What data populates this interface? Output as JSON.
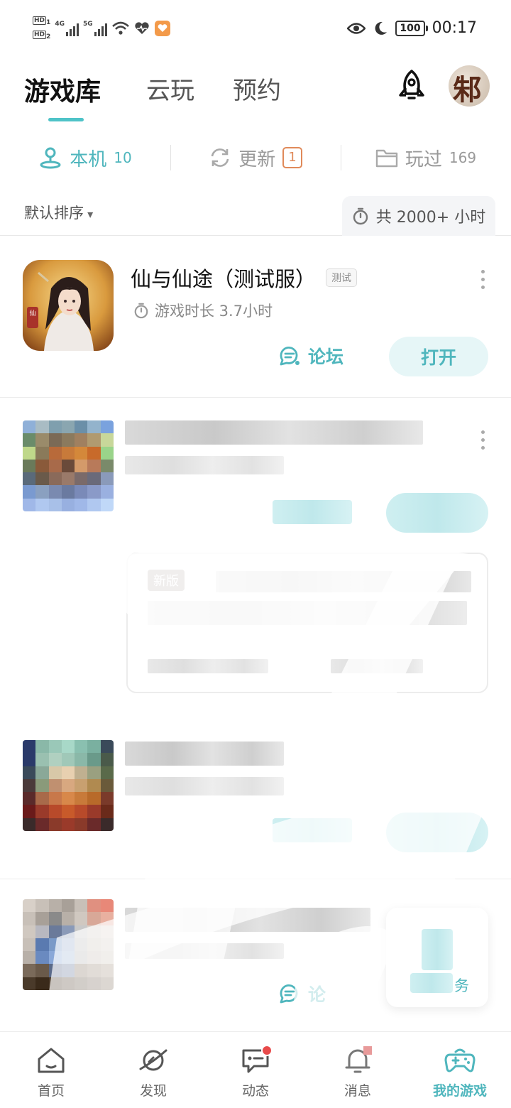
{
  "status_bar": {
    "hd1": "HD",
    "hd1_sub": "1",
    "hd2": "HD",
    "hd2_sub": "2",
    "net1": "4G",
    "net2": "5G",
    "battery": "100",
    "time": "00:17"
  },
  "header": {
    "tabs": [
      {
        "label": "游戏库",
        "active": true
      },
      {
        "label": "云玩",
        "active": false
      },
      {
        "label": "预约",
        "active": false
      }
    ],
    "avatar_text": "邾"
  },
  "filters": [
    {
      "label": "本机",
      "count": "10",
      "active": true
    },
    {
      "label": "更新",
      "count": "1",
      "active": false
    },
    {
      "label": "玩过",
      "count": "169",
      "active": false
    }
  ],
  "sort": {
    "label": "默认排序",
    "total_playtime": "共 2000+ 小时"
  },
  "games": [
    {
      "title": "仙与仙途（测试服）",
      "tag": "测试",
      "playtime": "游戏时长 3.7小时",
      "forum_label": "论坛",
      "open_label": "打开"
    }
  ],
  "obscured": {
    "news_tag": "新版",
    "forum_partial": "论",
    "task_partial": "务"
  },
  "bottom_nav": [
    {
      "label": "首页",
      "icon": "home-icon",
      "active": false
    },
    {
      "label": "发现",
      "icon": "planet-icon",
      "active": false
    },
    {
      "label": "动态",
      "icon": "chat-icon",
      "active": false,
      "dot": true
    },
    {
      "label": "消息",
      "icon": "bell-icon",
      "active": false
    },
    {
      "label": "我的游戏",
      "icon": "gamepad-icon",
      "active": true
    }
  ],
  "colors": {
    "accent": "#4fb6bd",
    "update_badge": "#e08a5a",
    "red_dot": "#e84a4a"
  }
}
